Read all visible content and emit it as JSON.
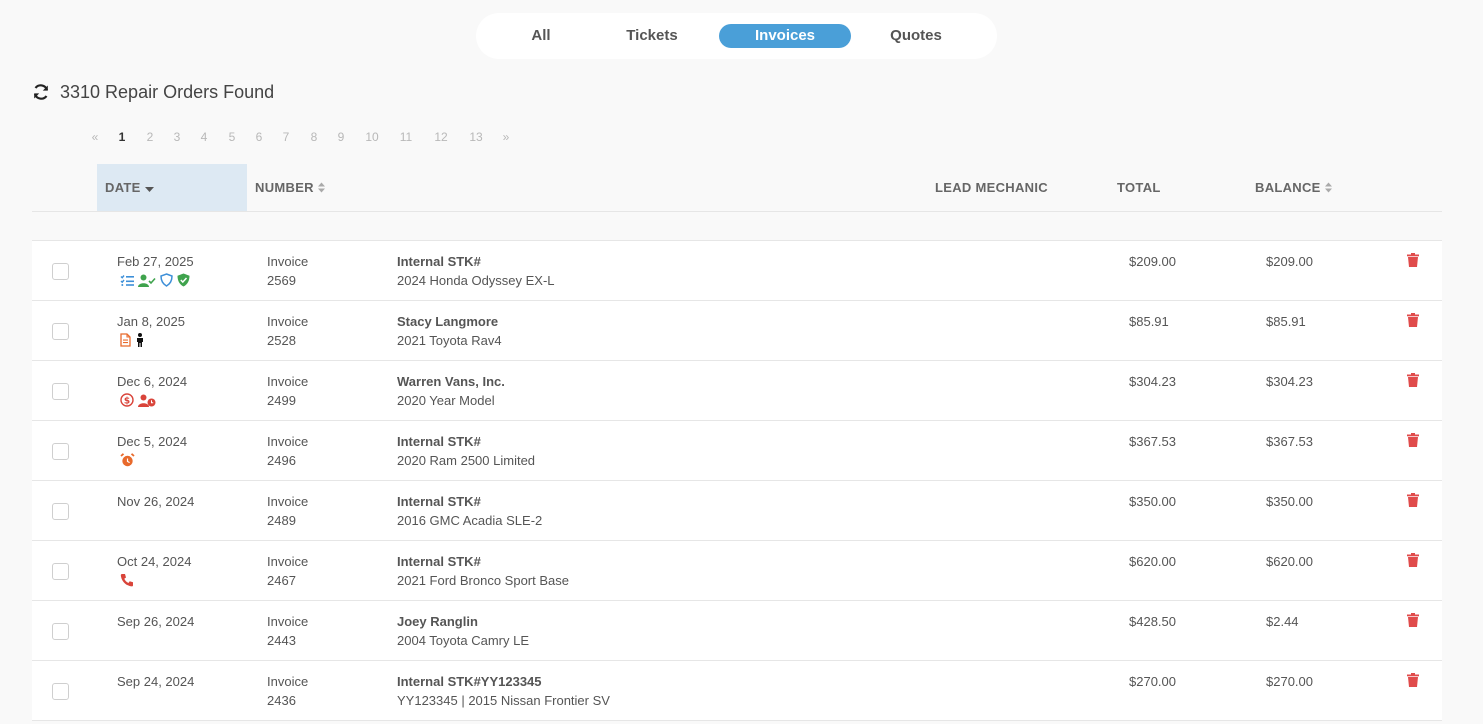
{
  "tabs": [
    {
      "label": "All",
      "active": false
    },
    {
      "label": "Tickets",
      "active": false
    },
    {
      "label": "Invoices",
      "active": true
    },
    {
      "label": "Quotes",
      "active": false
    }
  ],
  "results": {
    "count_text": "3310 Repair Orders Found"
  },
  "pagination": {
    "prev": "«",
    "next": "»",
    "pages": [
      "1",
      "2",
      "3",
      "4",
      "5",
      "6",
      "7",
      "8",
      "9",
      "10",
      "11",
      "12",
      "13"
    ],
    "current": "1"
  },
  "table": {
    "headers": {
      "date": "DATE",
      "number": "NUMBER",
      "lead_mechanic": "LEAD MECHANIC",
      "total": "TOTAL",
      "balance": "BALANCE"
    },
    "sorted_by": "date",
    "rows": [
      {
        "date": "Feb 27, 2025",
        "type": "Invoice",
        "number": "2569",
        "customer": "Internal STK#",
        "vehicle": "2024 Honda Odyssey EX-L",
        "total": "$209.00",
        "balance": "$209.00",
        "icons": [
          "checklist-icon",
          "user-check-icon",
          "shield-outline-icon",
          "shield-check-icon"
        ]
      },
      {
        "date": "Jan 8, 2025",
        "type": "Invoice",
        "number": "2528",
        "customer": "Stacy Langmore",
        "vehicle": "2021 Toyota Rav4",
        "total": "$85.91",
        "balance": "$85.91",
        "icons": [
          "document-icon",
          "person-icon"
        ]
      },
      {
        "date": "Dec 6, 2024",
        "type": "Invoice",
        "number": "2499",
        "customer": "Warren Vans, Inc.",
        "vehicle": "2020 Year Model",
        "total": "$304.23",
        "balance": "$304.23",
        "icons": [
          "dollar-circle-icon",
          "user-clock-icon"
        ]
      },
      {
        "date": "Dec 5, 2024",
        "type": "Invoice",
        "number": "2496",
        "customer": "Internal STK#",
        "vehicle": "2020 Ram 2500 Limited",
        "total": "$367.53",
        "balance": "$367.53",
        "icons": [
          "alarm-clock-icon"
        ]
      },
      {
        "date": "Nov 26, 2024",
        "type": "Invoice",
        "number": "2489",
        "customer": "Internal STK#",
        "vehicle": "2016 GMC Acadia SLE-2",
        "total": "$350.00",
        "balance": "$350.00",
        "icons": []
      },
      {
        "date": "Oct 24, 2024",
        "type": "Invoice",
        "number": "2467",
        "customer": "Internal STK#",
        "vehicle": "2021 Ford Bronco Sport Base",
        "total": "$620.00",
        "balance": "$620.00",
        "icons": [
          "phone-icon"
        ]
      },
      {
        "date": "Sep 26, 2024",
        "type": "Invoice",
        "number": "2443",
        "customer": "Joey Ranglin",
        "vehicle": "2004 Toyota Camry LE",
        "total": "$428.50",
        "balance": "$2.44",
        "icons": []
      },
      {
        "date": "Sep 24, 2024",
        "type": "Invoice",
        "number": "2436",
        "customer": "Internal STK#YY123345",
        "vehicle": "YY123345 | 2015 Nissan Frontier SV",
        "total": "$270.00",
        "balance": "$270.00",
        "icons": []
      }
    ]
  },
  "colors": {
    "accent": "#4a9fd8",
    "sorted_header_bg": "#dde9f3",
    "delete_red": "#e04b4b",
    "icon_blue": "#3d8fd8",
    "icon_green": "#3fa34d",
    "icon_red": "#d9443a",
    "icon_orange": "#e86a2c"
  }
}
